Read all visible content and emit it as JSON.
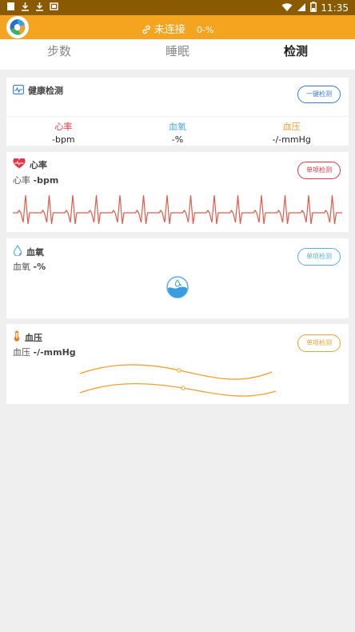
{
  "status_bar": {
    "time": "11:35"
  },
  "app_bar": {
    "connection_status": "未连接",
    "battery": "0-%"
  },
  "tabs": [
    {
      "label": "步数"
    },
    {
      "label": "睡眠"
    },
    {
      "label": "检测"
    }
  ],
  "health_check": {
    "title": "健康检测",
    "button": "一键检测",
    "metrics": [
      {
        "label": "心率",
        "value": "-bpm",
        "color": "#e8344a"
      },
      {
        "label": "血氧",
        "value": "-%",
        "color": "#4aa8e8"
      },
      {
        "label": "血压",
        "value": "-/-mmHg",
        "color": "#f0a030"
      }
    ]
  },
  "heart_rate": {
    "title": "心率",
    "subtitle_label": "心率",
    "subtitle_value": "-bpm",
    "button": "单项检测",
    "color": "#e8344a"
  },
  "blood_oxygen": {
    "title": "血氧",
    "subtitle_label": "血氧",
    "subtitle_value": "-%",
    "button": "单项检测",
    "color": "#5aaee8"
  },
  "blood_pressure": {
    "title": "血压",
    "subtitle_label": "血压",
    "subtitle_value": "-/-mmHg",
    "button": "单项检测",
    "color": "#f0a030"
  }
}
